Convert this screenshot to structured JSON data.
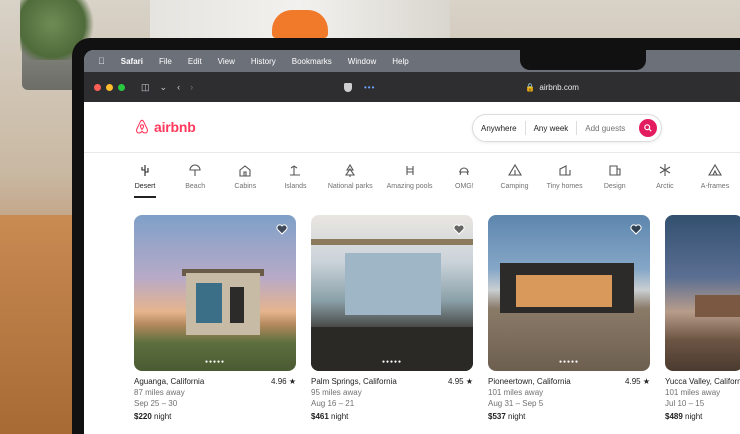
{
  "menubar": {
    "app": "Safari",
    "items": [
      "File",
      "Edit",
      "View",
      "History",
      "Bookmarks",
      "Window",
      "Help"
    ]
  },
  "browser": {
    "url": "airbnb.com"
  },
  "header": {
    "logo_text": "airbnb",
    "search": {
      "where": "Anywhere",
      "when": "Any week",
      "guests": "Add guests"
    }
  },
  "categories": [
    {
      "label": "Desert",
      "icon": "cactus-icon",
      "active": true
    },
    {
      "label": "Beach",
      "icon": "umbrella-icon"
    },
    {
      "label": "Cabins",
      "icon": "cabin-icon"
    },
    {
      "label": "Islands",
      "icon": "island-icon"
    },
    {
      "label": "National parks",
      "icon": "park-icon"
    },
    {
      "label": "Amazing pools",
      "icon": "pool-icon"
    },
    {
      "label": "OMG!",
      "icon": "ufo-icon"
    },
    {
      "label": "Camping",
      "icon": "tent-icon"
    },
    {
      "label": "Tiny homes",
      "icon": "tiny-home-icon"
    },
    {
      "label": "Design",
      "icon": "design-icon"
    },
    {
      "label": "Arctic",
      "icon": "snowflake-icon"
    },
    {
      "label": "A-frames",
      "icon": "a-frame-icon"
    }
  ],
  "listings": [
    {
      "location": "Aguanga, California",
      "rating": "4.96",
      "distance": "87 miles away",
      "dates": "Sep 25 – 30",
      "price": "$220",
      "price_suffix": "night"
    },
    {
      "location": "Palm Springs, California",
      "rating": "4.95",
      "distance": "95 miles away",
      "dates": "Aug 16 – 21",
      "price": "$461",
      "price_suffix": "night"
    },
    {
      "location": "Pioneertown, California",
      "rating": "4.95",
      "distance": "101 miles away",
      "dates": "Aug 31 – Sep 5",
      "price": "$537",
      "price_suffix": "night"
    },
    {
      "location": "Yucca Valley, California",
      "rating": "",
      "distance": "101 miles away",
      "dates": "Jul 10 – 15",
      "price": "$489",
      "price_suffix": "night"
    }
  ],
  "colors": {
    "brand": "#ff385c",
    "search_button": "#e31c5f"
  }
}
